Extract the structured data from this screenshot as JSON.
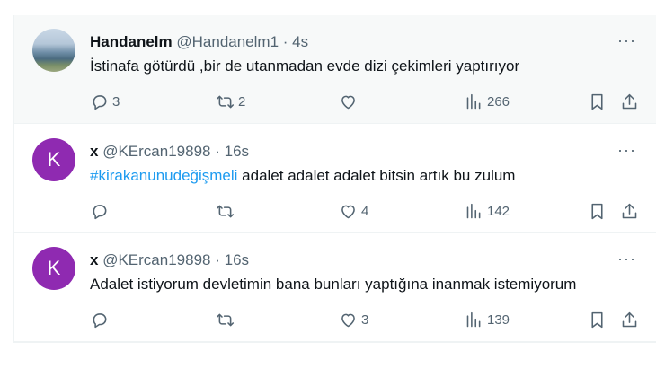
{
  "tweets": [
    {
      "avatar_letter": "",
      "name": "Handanelm",
      "handle": "@Handanelm1",
      "dot": "·",
      "time": "4s",
      "more": "···",
      "text_hashtag": "",
      "text": "İstinafa götürdü ,bir de utanmadan evde dizi çekimleri yaptırıyor",
      "replies": "3",
      "retweets": "2",
      "likes": "",
      "views": "266"
    },
    {
      "avatar_letter": "K",
      "name": "x",
      "handle": "@KErcan19898",
      "dot": "·",
      "time": "16s",
      "more": "···",
      "text_hashtag": "#kirakanunudeğişmeli",
      "text": " adalet adalet adalet bitsin artık bu zulum",
      "replies": "",
      "retweets": "",
      "likes": "4",
      "views": "142"
    },
    {
      "avatar_letter": "K",
      "name": "x",
      "handle": "@KErcan19898",
      "dot": "·",
      "time": "16s",
      "more": "···",
      "text_hashtag": "",
      "text": "Adalet istiyorum devletimin bana bunları yaptığına inanmak istemiyorum",
      "replies": "",
      "retweets": "",
      "likes": "3",
      "views": "139"
    }
  ],
  "icons": {
    "reply": "reply-icon",
    "retweet": "retweet-icon",
    "like": "heart-icon",
    "views": "views-icon",
    "bookmark": "bookmark-icon",
    "share": "share-icon"
  },
  "colors": {
    "accent": "#1d9bf0",
    "avatar_bg": "#8f2ab1",
    "muted": "#536471"
  }
}
